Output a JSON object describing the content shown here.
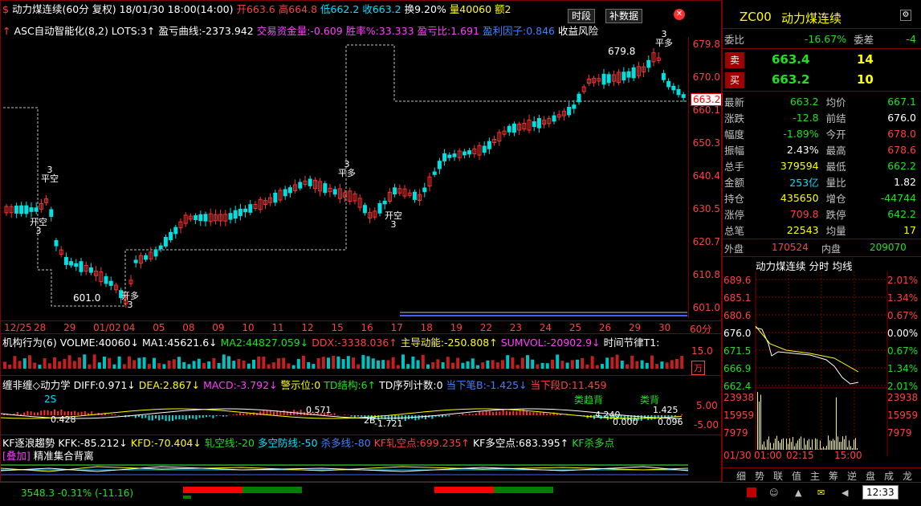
{
  "header": {
    "symbol_title": "动力煤连续(60分 复权)",
    "datetime": "18/01/30 18:00(14:00)",
    "open_label": "开663.6",
    "high_label": "高664.8",
    "low_label": "低662.2",
    "close_label": "收663.2",
    "turnover_label": "换9.20%",
    "volume_label": "量40060",
    "amount_label": "额2",
    "btn_time_section": "时段",
    "btn_fill_data": "补数据",
    "indicator_line": {
      "name": "ASC自动智能化(8,2) LOTS:3↑",
      "pnl_curve": "盈亏曲线:-2373.942",
      "fund": "交易资金量:-0.609",
      "winrate": "胜率%:33.333",
      "pnl_ratio": "盈亏比:1.691",
      "profit_factor": "盈利因子:0.846",
      "yield_label": "收益风险"
    }
  },
  "price_axis": {
    "labels": [
      "679.8",
      "670.0",
      "660.1",
      "650.3",
      "640.4",
      "630.5",
      "620.7",
      "610.8",
      "601.0"
    ],
    "current_price": "663.2"
  },
  "annotations": {
    "high_mark": "679.8",
    "low_mark": "601.0",
    "signals": [
      {
        "text": "开空",
        "num": "3"
      },
      {
        "text": "平空",
        "num": "3"
      },
      {
        "text": "开多",
        "num": "3"
      },
      {
        "text": "平多",
        "num": "3"
      },
      {
        "text": "开空",
        "num": "3"
      },
      {
        "text": "平多",
        "num": "3"
      },
      {
        "text": "平空",
        "num": "3"
      }
    ]
  },
  "date_axis": {
    "labels": [
      "12/25",
      "28",
      "29",
      "01/02",
      "04",
      "05",
      "08",
      "09",
      "10",
      "11",
      "12",
      "15",
      "16",
      "17",
      "18",
      "19",
      "22",
      "23",
      "24",
      "25",
      "26",
      "29",
      "30"
    ],
    "period": "60分"
  },
  "volume_panel": {
    "title": "机构行为(6)",
    "volme": "VOLME:40060↓",
    "ma1": "MA1:45621.6↓",
    "ma2": "MA2:44827.059↓",
    "ddx": "DDX:-3338.036↑",
    "main_power": "主导动能:-250.808↑",
    "sumvol": "SUMVOL:-20902.9↓",
    "time_rhythm": "时间节律T1:",
    "axis_15": "15.0",
    "axis_unit": "万"
  },
  "macd_panel": {
    "title": "缠非缠◇动力学",
    "diff": "DIFF:0.971↓",
    "dea": "DEA:2.867↓",
    "macd": "MACD:-3.792↓",
    "warn": "警示位:0",
    "td": "TD结构:6↑",
    "td_count": "TD序列计数:0",
    "lower_bi": "当下笔B:-1.425↓",
    "lower_seg": "当下段D:11.459",
    "labels": {
      "s2": "2S",
      "v1": "0.428",
      "v2": "0.571",
      "v3": "-1.721",
      "s2b": "2B",
      "v4": "4.240",
      "v5": "0.000",
      "v6": "1.425",
      "v7": "0.096",
      "bei1": "类趋背",
      "bei2": "类背",
      "bei3": "类趋背"
    },
    "axis": [
      "5.00",
      "-5.00"
    ]
  },
  "kf_panel": {
    "title": "KF逐浪趨勢",
    "kfk": "KFK:-85.212↓",
    "kfd": "KFD:-70.404↓",
    "zha_kong": "轧空线:-20",
    "duo_kong": "多空防线:-50",
    "sha_duo": "杀多线:-80",
    "kf_zha_kong_pt": "KF轧空点:699.235↑",
    "kf_duo_kong_pt": "KF多空点:683.395↑",
    "kf_sha_duo": "KF杀多点",
    "overlay": "[叠加]",
    "sub": "精准集合背离"
  },
  "quote_panel": {
    "code": "ZC00",
    "name": "动力煤连续",
    "weibi_label": "委比",
    "weibi_value": "-16.67%",
    "weicha_label": "委差",
    "weicha_value": "-4",
    "sell_label": "卖",
    "sell_price": "663.4",
    "sell_qty": "14",
    "buy_label": "买",
    "buy_price": "663.2",
    "buy_qty": "10",
    "rows": [
      {
        "l1": "最新",
        "v1": "663.2",
        "l2": "均价",
        "v2": "667.1"
      },
      {
        "l1": "涨跌",
        "v1": "-12.8",
        "l2": "前结",
        "v2": "676.0"
      },
      {
        "l1": "幅度",
        "v1": "-1.89%",
        "l2": "今开",
        "v2": "678.0"
      },
      {
        "l1": "振幅",
        "v1": "2.43%",
        "l2": "最高",
        "v2": "678.6"
      },
      {
        "l1": "总手",
        "v1": "379594",
        "l2": "最低",
        "v2": "662.2"
      },
      {
        "l1": "金额",
        "v1": "253亿",
        "l2": "量比",
        "v2": "1.82"
      },
      {
        "l1": "持仓",
        "v1": "435650",
        "l2": "增仓",
        "v2": "-44744"
      },
      {
        "l1": "涨停",
        "v1": "709.8",
        "l2": "跌停",
        "v2": "642.2"
      },
      {
        "l1": "总笔",
        "v1": "22543",
        "l2": "均量",
        "v2": "17"
      }
    ],
    "waipan_label": "外盘",
    "waipan_value": "170524",
    "neipan_label": "内盘",
    "neipan_value": "209070"
  },
  "mini_chart": {
    "title": "动力煤连续 分时 均线",
    "left_axis": [
      "689.6",
      "685.1",
      "680.6",
      "676.0",
      "671.5",
      "666.9",
      "662.4"
    ],
    "right_axis": [
      "2.01%",
      "1.34%",
      "0.67%",
      "0.00%",
      "0.67%",
      "1.34%",
      "2.01%"
    ],
    "vol_axis": [
      "23938",
      "15959",
      "7979"
    ],
    "time_labels": [
      "01/30",
      "01:00",
      "02:15",
      "15:00"
    ]
  },
  "bottom_tabs": [
    "细",
    "势",
    "联",
    "值",
    "主",
    "筹",
    "逆",
    "盘",
    "成",
    "龙"
  ],
  "status": {
    "index_text": "3548.3  -0.31% (-11.16)",
    "clock": "12:33"
  }
}
